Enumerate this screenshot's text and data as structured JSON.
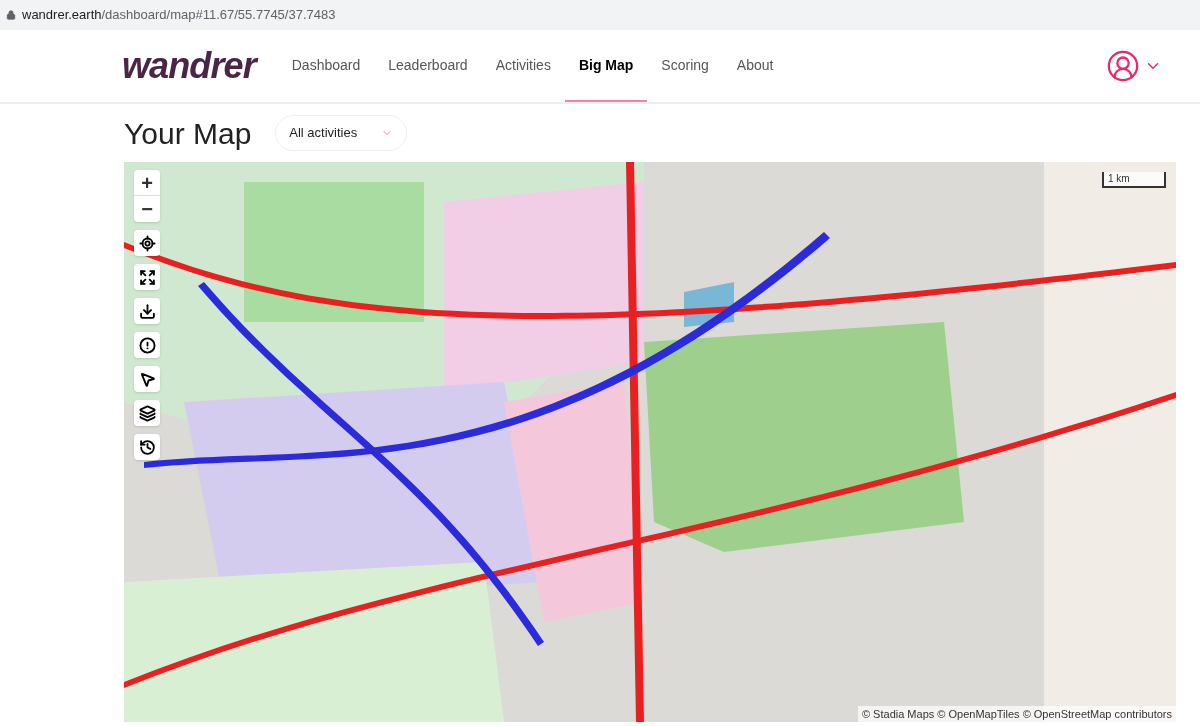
{
  "address_bar": {
    "host": "wandrer.earth",
    "path": "/dashboard/map#11.67/55.7745/37.7483"
  },
  "nav": {
    "logo": "wandrer",
    "items": [
      {
        "label": "Dashboard",
        "selected": false
      },
      {
        "label": "Leaderboard",
        "selected": false
      },
      {
        "label": "Activities",
        "selected": false
      },
      {
        "label": "Big Map",
        "selected": true
      },
      {
        "label": "Scoring",
        "selected": false
      },
      {
        "label": "About",
        "selected": false
      }
    ]
  },
  "page": {
    "title": "Your Map",
    "filter": {
      "value": "All activities"
    }
  },
  "map": {
    "zoom_in": "+",
    "zoom_out": "−",
    "scale": "1 km",
    "attribution": "© Stadia Maps © OpenMapTiles © OpenStreetMap contributors"
  }
}
